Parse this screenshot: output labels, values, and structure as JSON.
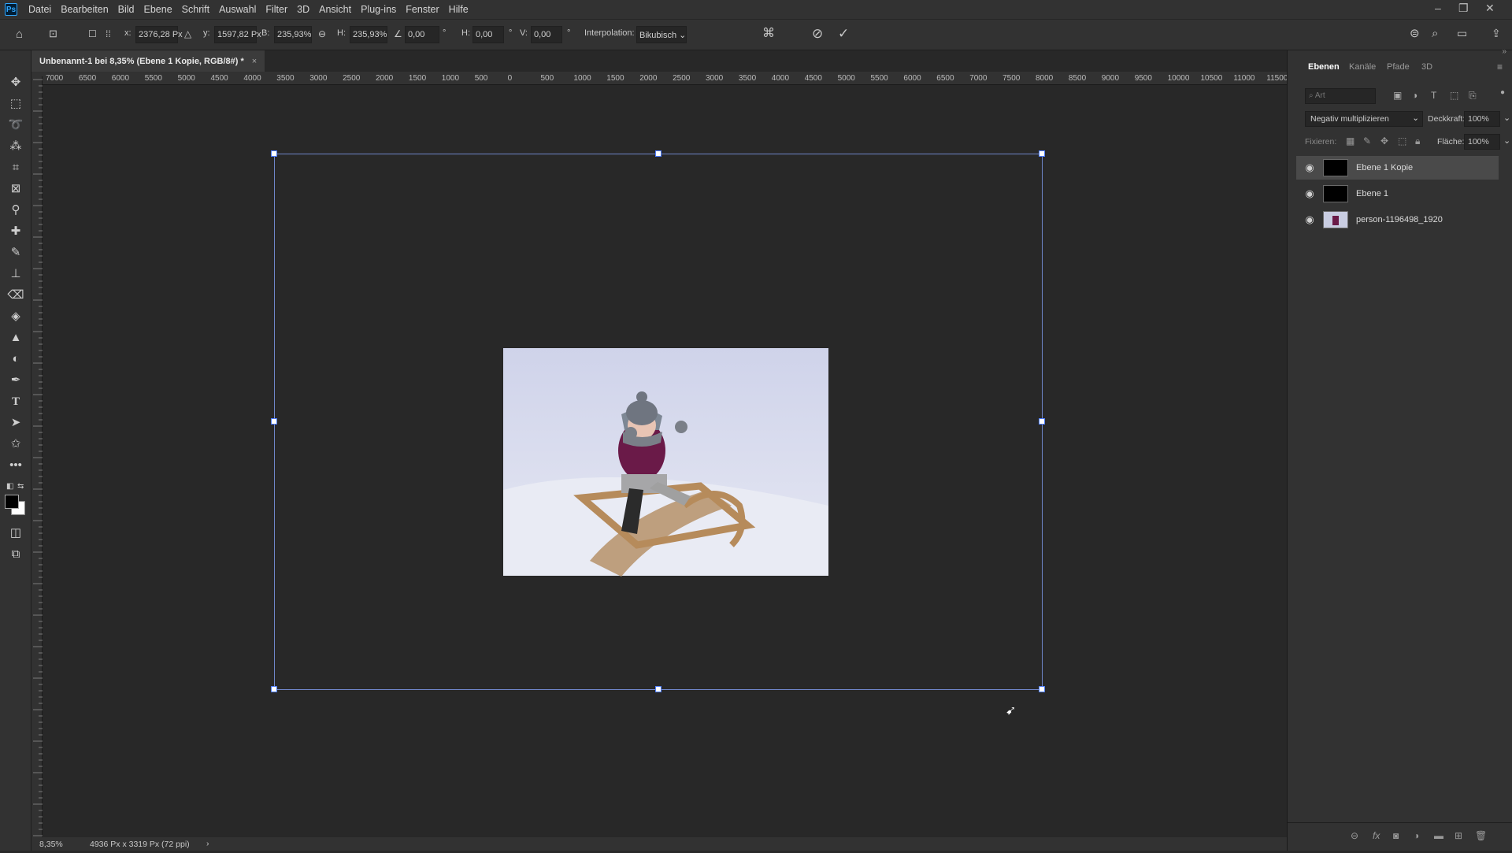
{
  "app": {
    "logo": "Ps"
  },
  "menu": [
    "Datei",
    "Bearbeiten",
    "Bild",
    "Ebene",
    "Schrift",
    "Auswahl",
    "Filter",
    "3D",
    "Ansicht",
    "Plug-ins",
    "Fenster",
    "Hilfe"
  ],
  "options": {
    "x_label": "x:",
    "x_value": "2376,28 Px",
    "y_label": "y:",
    "y_value": "1597,82 Px",
    "b_label": "B:",
    "b_value": "235,93%",
    "h_label": "H:",
    "h_value": "235,93%",
    "angle_value": "0,00",
    "deg": "°",
    "hskew_label": "H:",
    "hskew_value": "0,00",
    "vskew_label": "V:",
    "vskew_value": "0,00",
    "interp_label": "Interpolation:",
    "interp_value": "Bikubisch"
  },
  "document": {
    "tab_title": "Unbenannt-1 bei 8,35% (Ebene 1 Kopie, RGB/8#) *",
    "close": "×"
  },
  "ruler_h": [
    "7000",
    "6500",
    "6000",
    "5500",
    "5000",
    "4500",
    "4000",
    "3500",
    "3000",
    "2500",
    "2000",
    "1500",
    "1000",
    "500",
    "0",
    "500",
    "1000",
    "1500",
    "2000",
    "2500",
    "3000",
    "3500",
    "4000",
    "4500",
    "5000",
    "5500",
    "6000",
    "6500",
    "7000",
    "7500",
    "8000",
    "8500",
    "9000",
    "9500",
    "10000",
    "10500",
    "11000",
    "11500"
  ],
  "status": {
    "zoom": "8,35%",
    "info": "4936 Px x 3319 Px (72 ppi)",
    "arrow": "›"
  },
  "panel": {
    "tabs": [
      "Ebenen",
      "Kanäle",
      "Pfade",
      "3D"
    ],
    "search_placeholder": "Art",
    "blend_mode": "Negativ multiplizieren",
    "opacity_label": "Deckkraft:",
    "opacity_value": "100%",
    "lock_label": "Fixieren:",
    "fill_label": "Fläche:",
    "fill_value": "100%",
    "layers": [
      {
        "name": "Ebene 1 Kopie",
        "selected": true,
        "thumb": "#000000"
      },
      {
        "name": "Ebene 1",
        "selected": false,
        "thumb": "#000000"
      },
      {
        "name": "person-1196498_1920",
        "selected": false,
        "thumb": "photo"
      }
    ]
  },
  "colors": {
    "accent": "#4d7cff",
    "canvas": "#282828",
    "panel": "#323232"
  }
}
